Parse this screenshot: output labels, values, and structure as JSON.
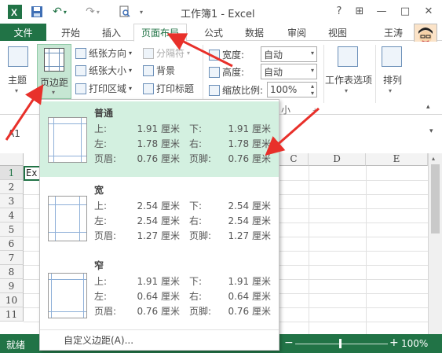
{
  "window": {
    "title": "工作簿1 - Excel",
    "help": "?",
    "ribbon_display": "⊞",
    "minimize": "—",
    "restore": "□",
    "close": "✕"
  },
  "quick_access": {
    "undo": "↶",
    "redo": "↷"
  },
  "tabs": {
    "file": "文件",
    "home": "开始",
    "insert": "插入",
    "page_layout": "页面布局",
    "formulas": "公式",
    "data": "数据",
    "review": "审阅",
    "view": "视图",
    "user": "王涛",
    "active": "页面布局"
  },
  "ribbon": {
    "themes": "主题",
    "margins": "页边距",
    "orientation": "纸张方向",
    "size": "纸张大小",
    "print_area": "打印区域",
    "breaks": "分隔符",
    "background": "背景",
    "print_titles": "打印标题",
    "width_label": "宽度:",
    "width_value": "自动",
    "height_label": "高度:",
    "height_value": "自动",
    "scale_label": "缩放比例:",
    "scale_value": "100%",
    "sheet_options": "工作表选项",
    "arrange": "排列",
    "group_suffix": "小"
  },
  "formula_bar": {
    "name_box": "A1"
  },
  "sheet": {
    "columns": [
      "C",
      "D",
      "E"
    ],
    "rows": [
      "1",
      "2",
      "3",
      "4",
      "5",
      "6",
      "7",
      "8",
      "9",
      "10",
      "11"
    ],
    "a1_value": "Ex"
  },
  "margins_gallery": {
    "items": [
      {
        "name": "普通",
        "top_label": "上:",
        "top": "1.91 厘米",
        "bottom_label": "下:",
        "bottom": "1.91 厘米",
        "left_label": "左:",
        "left": "1.78 厘米",
        "right_label": "右:",
        "right": "1.78 厘米",
        "header_label": "页眉:",
        "header": "0.76 厘米",
        "footer_label": "页脚:",
        "footer": "0.76 厘米"
      },
      {
        "name": "宽",
        "top_label": "上:",
        "top": "2.54 厘米",
        "bottom_label": "下:",
        "bottom": "2.54 厘米",
        "left_label": "左:",
        "left": "2.54 厘米",
        "right_label": "右:",
        "right": "2.54 厘米",
        "header_label": "页眉:",
        "header": "1.27 厘米",
        "footer_label": "页脚:",
        "footer": "1.27 厘米"
      },
      {
        "name": "窄",
        "top_label": "上:",
        "top": "1.91 厘米",
        "bottom_label": "下:",
        "bottom": "1.91 厘米",
        "left_label": "左:",
        "left": "0.64 厘米",
        "right_label": "右:",
        "right": "0.64 厘米",
        "header_label": "页眉:",
        "header": "0.76 厘米",
        "footer_label": "页脚:",
        "footer": "0.76 厘米"
      }
    ],
    "custom": "自定义边距(A)..."
  },
  "status_bar": {
    "ready": "就绪",
    "zoom_minus": "−",
    "zoom_plus": "+",
    "zoom": "100%"
  },
  "colors": {
    "excel_green": "#217346",
    "hover_green": "#d3f0e0",
    "arrow_red": "#e8302a"
  }
}
